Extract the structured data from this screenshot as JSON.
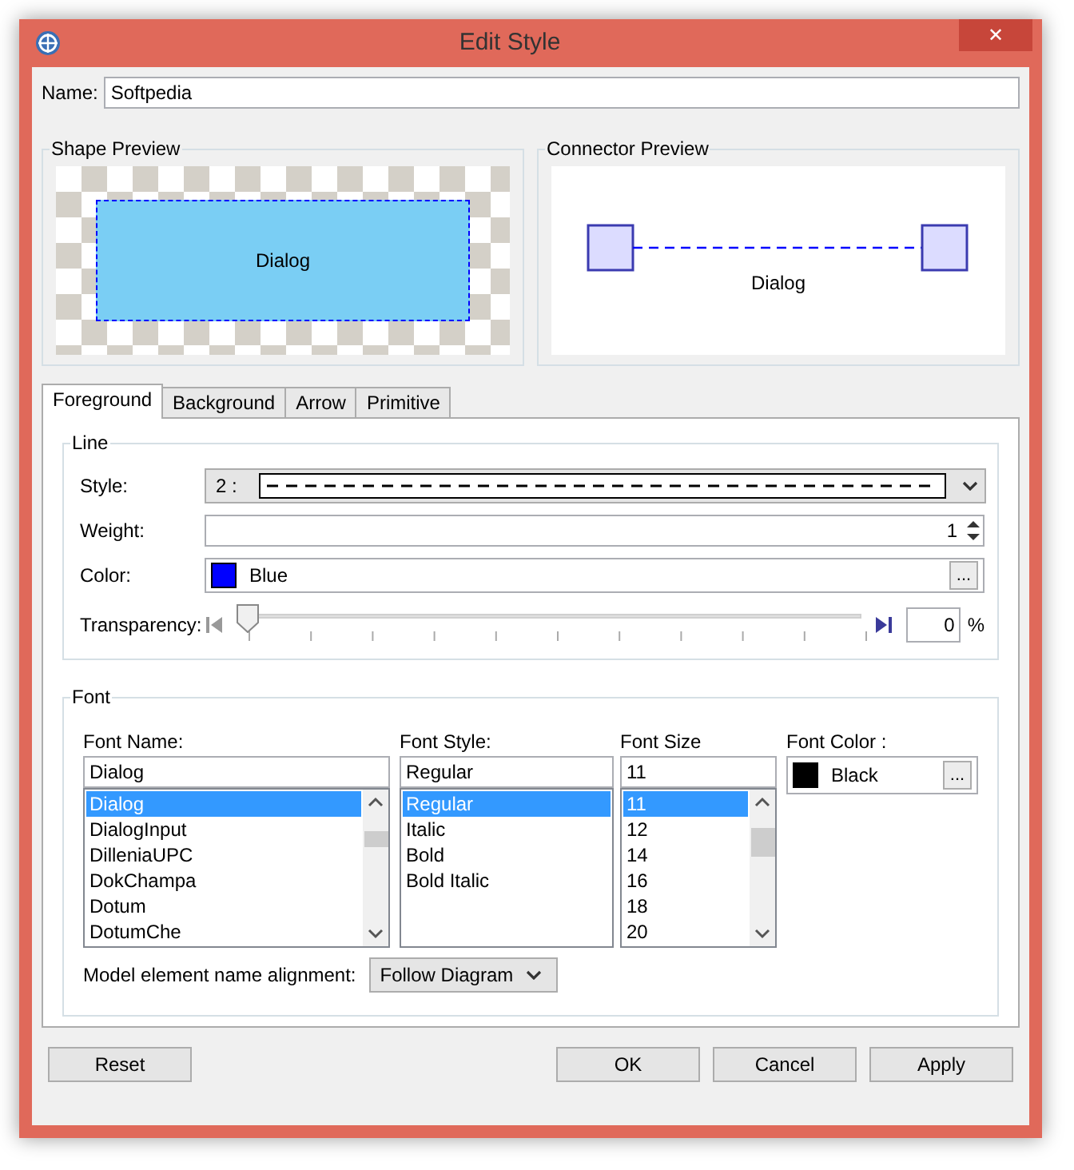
{
  "window": {
    "title": "Edit Style",
    "close": "✕"
  },
  "name_field": {
    "label": "Name:",
    "value": "Softpedia"
  },
  "shape_preview": {
    "title": "Shape Preview",
    "shape_label": "Dialog"
  },
  "connector_preview": {
    "title": "Connector Preview",
    "connector_label": "Dialog"
  },
  "tabs": [
    {
      "label": "Foreground",
      "selected": true
    },
    {
      "label": "Background",
      "selected": false
    },
    {
      "label": "Arrow",
      "selected": false
    },
    {
      "label": "Primitive",
      "selected": false
    }
  ],
  "line": {
    "title": "Line",
    "style": {
      "label": "Style:",
      "value": "2 :"
    },
    "weight": {
      "label": "Weight:",
      "value": "1"
    },
    "color": {
      "label": "Color:",
      "value": "Blue",
      "color": "#0000ff",
      "button": "..."
    },
    "transparency": {
      "label": "Transparency:",
      "level": 0,
      "value": "0",
      "unit": "%"
    }
  },
  "font": {
    "title": "Font",
    "name": {
      "label": "Font Name:",
      "value": "Dialog",
      "options": [
        {
          "label": "Dialog",
          "selected": true
        },
        {
          "label": "DialogInput",
          "selected": false
        },
        {
          "label": "DilleniaUPC",
          "selected": false
        },
        {
          "label": "DokChampa",
          "selected": false
        },
        {
          "label": "Dotum",
          "selected": false
        },
        {
          "label": "DotumChe",
          "selected": false
        }
      ]
    },
    "style": {
      "label": "Font Style:",
      "value": "Regular",
      "options": [
        {
          "label": "Regular",
          "selected": true
        },
        {
          "label": "Italic",
          "selected": false
        },
        {
          "label": "Bold",
          "selected": false
        },
        {
          "label": "Bold Italic",
          "selected": false
        }
      ]
    },
    "size": {
      "label": "Font Size",
      "value": "11",
      "options": [
        {
          "label": "11",
          "selected": true
        },
        {
          "label": "12",
          "selected": false
        },
        {
          "label": "14",
          "selected": false
        },
        {
          "label": "16",
          "selected": false
        },
        {
          "label": "18",
          "selected": false
        },
        {
          "label": "20",
          "selected": false
        }
      ]
    },
    "color": {
      "label": "Font Color :",
      "value": "Black",
      "color": "#000000",
      "button": "..."
    },
    "alignment": {
      "label": "Model element name alignment:",
      "value": "Follow Diagram"
    }
  },
  "buttons_left": [
    "Reset"
  ],
  "buttons_right": [
    "OK",
    "Cancel",
    "Apply"
  ]
}
